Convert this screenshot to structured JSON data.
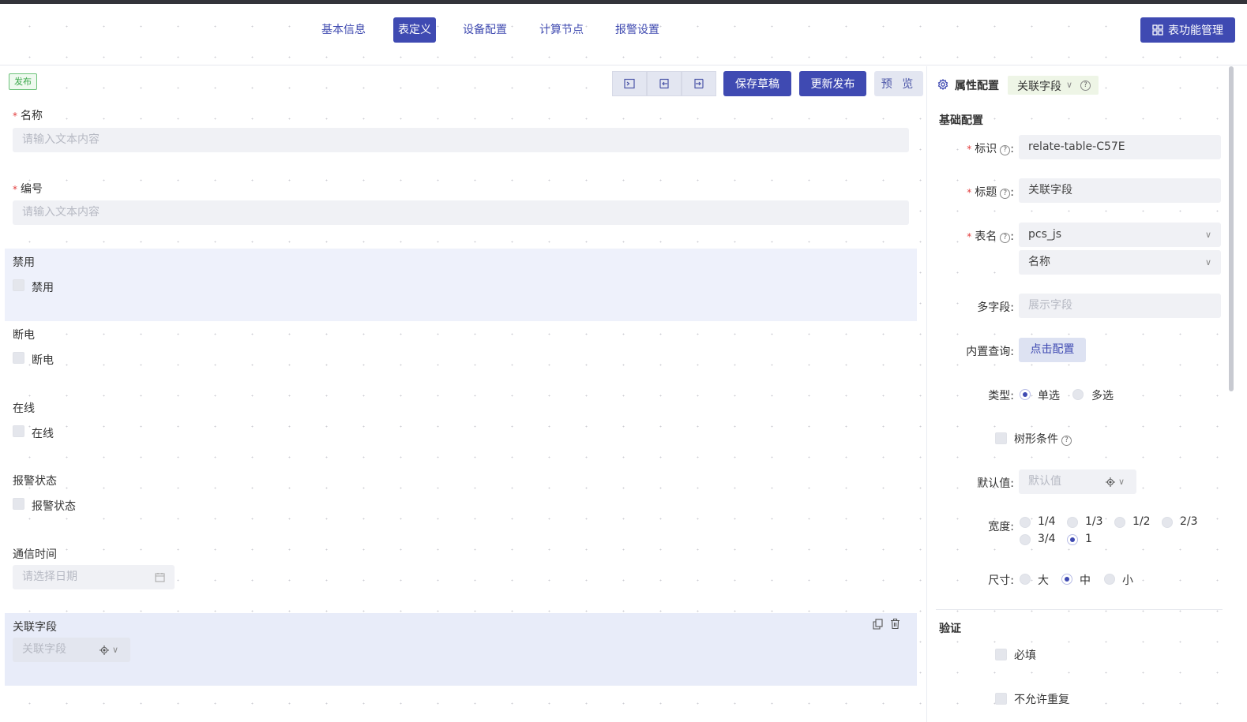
{
  "nav": {
    "tabs": [
      {
        "label": "基本信息"
      },
      {
        "label": "表定义"
      },
      {
        "label": "设备配置"
      },
      {
        "label": "计算节点"
      },
      {
        "label": "报警设置"
      }
    ],
    "active_tab": "表定义",
    "func_button": "表功能管理"
  },
  "toolbar": {
    "status_badge": "发布",
    "save_draft": "保存草稿",
    "update_publish": "更新发布",
    "preview": "预 览"
  },
  "form": {
    "name_label": "名称",
    "name_placeholder": "请输入文本内容",
    "code_label": "编号",
    "code_placeholder": "请输入文本内容",
    "disabled_title": "禁用",
    "disabled_checkbox": "禁用",
    "poweroff_title": "断电",
    "poweroff_checkbox": "断电",
    "online_title": "在线",
    "online_checkbox": "在线",
    "alarm_title": "报警状态",
    "alarm_checkbox": "报警状态",
    "comm_time_label": "通信时间",
    "comm_time_placeholder": "请选择日期",
    "relate_label": "关联字段",
    "relate_placeholder": "关联字段"
  },
  "panel": {
    "title": "属性配置",
    "component_type": "关联字段",
    "basic_section": "基础配置",
    "id_label": "标识",
    "id_value": "relate-table-C57E",
    "title_label": "标题",
    "title_value": "关联字段",
    "table_label": "表名",
    "table_value": "pcs_js",
    "table_field_value": "名称",
    "multi_label": "多字段:",
    "multi_placeholder": "展示字段",
    "query_label": "内置查询:",
    "query_button": "点击配置",
    "type_label": "类型:",
    "type_options": [
      "单选",
      "多选"
    ],
    "type_selected": "单选",
    "tree_label": "树形条件",
    "default_label": "默认值:",
    "default_placeholder": "默认值",
    "width_label": "宽度:",
    "width_options": [
      "1/4",
      "1/3",
      "1/2",
      "2/3",
      "3/4",
      "1"
    ],
    "width_selected": "1",
    "size_label": "尺寸:",
    "size_options": [
      "大",
      "中",
      "小"
    ],
    "size_selected": "中",
    "validate_section": "验证",
    "required_label": "必填",
    "unique_label": "不允许重复"
  },
  "colors": {
    "primary": "#3f4ab2",
    "band": "#eef1fb",
    "input_bg": "#f0f1f5",
    "required": "#e23b3b",
    "published": "#3aa64a"
  }
}
